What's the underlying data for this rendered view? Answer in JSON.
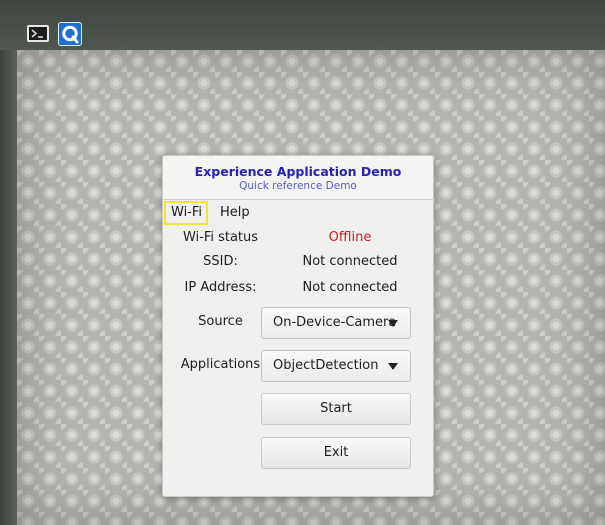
{
  "app": {
    "title": "Experience Application Demo",
    "subtitle": "Quick reference Demo"
  },
  "menu": {
    "items": [
      "Wi-Fi",
      "Help"
    ]
  },
  "info": {
    "wifi_status_label": "Wi-Fi status",
    "wifi_status_value": "Offline",
    "ssid_label": "SSID:",
    "ssid_value": "Not connected",
    "ip_label": "IP Address:",
    "ip_value": "Not connected"
  },
  "source": {
    "label": "Source",
    "selected": "On-Device-Camera"
  },
  "applications": {
    "label": "Applications",
    "selected": "ObjectDetection"
  },
  "buttons": {
    "start": "Start",
    "exit": "Exit"
  },
  "colors": {
    "title": "#2424b0",
    "status_offline": "#c81d1d",
    "menu_highlight": "#f0e33a"
  },
  "icons": [
    "terminal-icon",
    "qt-icon",
    "dropdown-arrow-icon"
  ]
}
